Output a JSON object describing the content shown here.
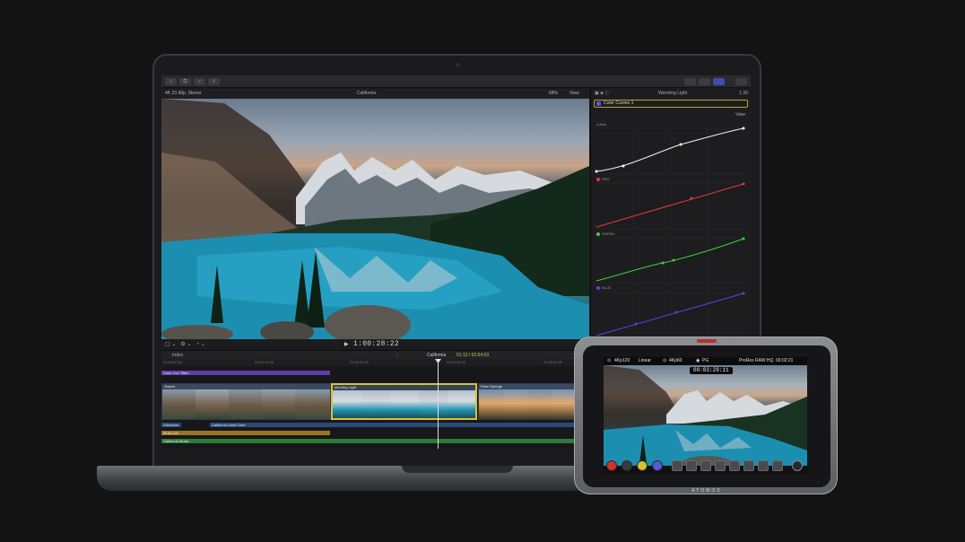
{
  "viewer": {
    "format": "4K 23.98p, Stereo",
    "clip_title": "California",
    "zoom": "68%",
    "view_label": "View",
    "timecode": "1:00:28:22"
  },
  "inspector": {
    "title": "Warming Light",
    "duration": "1:30",
    "effect_name": "Color Curves 1",
    "view_label": "View",
    "curves": [
      {
        "label": "LUMA",
        "color": "#ffffff"
      },
      {
        "label": "RED",
        "color": "#e23b3b"
      },
      {
        "label": "GREEN",
        "color": "#3fd03f"
      },
      {
        "label": "BLUE",
        "color": "#4b4be6"
      }
    ]
  },
  "timeline": {
    "index_label": "Index",
    "project": "California",
    "position": "01:12 / 02:54:03",
    "ruler": [
      "01:00:00:00",
      "01:00:10:00",
      "01:00:20:00",
      "01:00:30:00",
      "01:00:40:00"
    ],
    "tracks": {
      "title": "Color Cov Titles",
      "clip1": "Yosem",
      "clip2": "Morning Light",
      "clip3": "Palm Springs",
      "audio1": "Voiceover",
      "audio2": "California Voice Over",
      "audio3": "Music sfx",
      "audio4": "California Music"
    }
  },
  "atomos": {
    "brand": "ATOMOS",
    "status": {
      "resolution": "4Kp120",
      "gamma": "Linear",
      "rec_format": "4Kp60",
      "scene": "PG",
      "codec": "ProRes RAW HQ",
      "remaining": "00:02:21"
    },
    "timecode": "00:03:29:11"
  },
  "colors": {
    "accent_yellow": "#d2c05a",
    "title_track": "#5e3fa8",
    "music_track": "#2d7a3a",
    "sfx_track": "#9a7426",
    "voice_track": "#2b4a78"
  }
}
